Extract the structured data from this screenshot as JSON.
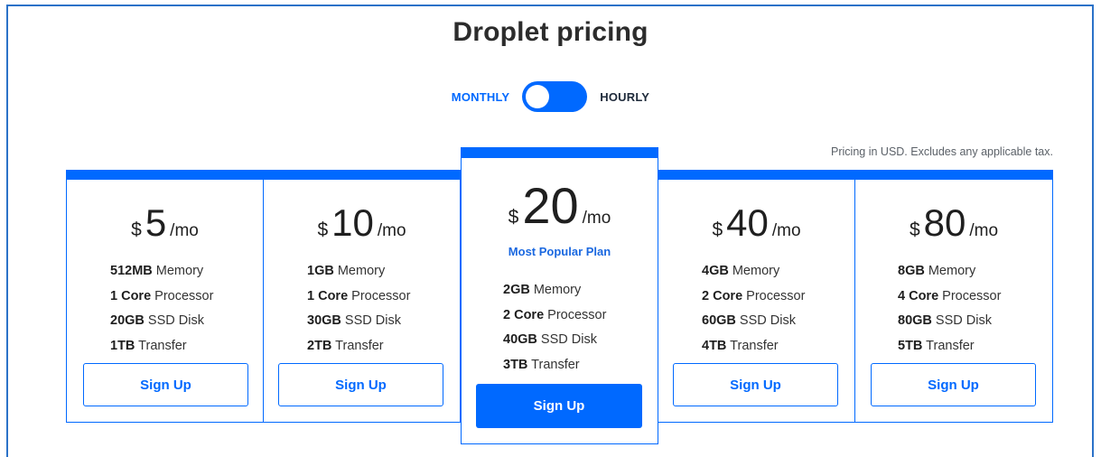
{
  "page": {
    "title": "Droplet pricing",
    "tax_note": "Pricing in USD. Excludes any applicable tax."
  },
  "billing_toggle": {
    "monthly_label": "MONTHLY",
    "hourly_label": "HOURLY",
    "selected": "MONTHLY"
  },
  "colors": {
    "accent": "#0069ff",
    "frame": "#2b72c8",
    "text": "#222222"
  },
  "plans": [
    {
      "currency": "$",
      "amount": "5",
      "period": "/mo",
      "memory_value": "512MB",
      "memory_label": " Memory",
      "cpu_value": "1 Core",
      "cpu_label": " Processor",
      "disk_value": "20GB",
      "disk_label": " SSD Disk",
      "transfer_value": "1TB",
      "transfer_label": " Transfer",
      "cta": "Sign Up"
    },
    {
      "currency": "$",
      "amount": "10",
      "period": "/mo",
      "memory_value": "1GB",
      "memory_label": " Memory",
      "cpu_value": "1 Core",
      "cpu_label": " Processor",
      "disk_value": "30GB",
      "disk_label": " SSD Disk",
      "transfer_value": "2TB",
      "transfer_label": " Transfer",
      "cta": "Sign Up"
    },
    {
      "currency": "$",
      "amount": "20",
      "period": "/mo",
      "badge": "Most Popular Plan",
      "memory_value": "2GB",
      "memory_label": " Memory",
      "cpu_value": "2 Core",
      "cpu_label": " Processor",
      "disk_value": "40GB",
      "disk_label": " SSD Disk",
      "transfer_value": "3TB",
      "transfer_label": " Transfer",
      "cta": "Sign Up"
    },
    {
      "currency": "$",
      "amount": "40",
      "period": "/mo",
      "memory_value": "4GB",
      "memory_label": " Memory",
      "cpu_value": "2 Core",
      "cpu_label": " Processor",
      "disk_value": "60GB",
      "disk_label": " SSD Disk",
      "transfer_value": "4TB",
      "transfer_label": " Transfer",
      "cta": "Sign Up"
    },
    {
      "currency": "$",
      "amount": "80",
      "period": "/mo",
      "memory_value": "8GB",
      "memory_label": " Memory",
      "cpu_value": "4 Core",
      "cpu_label": " Processor",
      "disk_value": "80GB",
      "disk_label": " SSD Disk",
      "transfer_value": "5TB",
      "transfer_label": " Transfer",
      "cta": "Sign Up"
    }
  ]
}
